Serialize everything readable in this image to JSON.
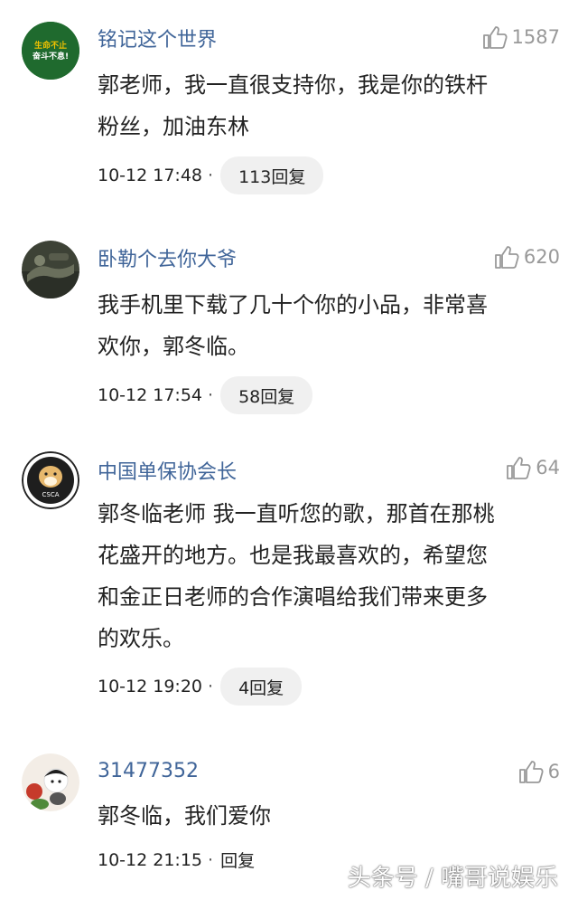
{
  "comments": [
    {
      "username": "铭记这个世界",
      "likes": "1587",
      "content_lines": [
        "郭老师，我一直很支持你，我是你的铁杆",
        "粉丝，加油东林"
      ],
      "time": "10-12 17:48",
      "replies": "113回复",
      "avatar_text_1": "生命不止",
      "avatar_text_2": "奋斗不息!"
    },
    {
      "username": "卧勒个去你大爷",
      "likes": "620",
      "content_lines": [
        "我手机里下载了几十个你的小品，非常喜",
        "欢你，郭冬临。"
      ],
      "time": "10-12 17:54",
      "replies": "58回复"
    },
    {
      "username": "中国单保协会长",
      "likes": "64",
      "content_lines": [
        "郭冬临老师 我一直听您的歌，那首在那桃",
        "花盛开的地方。也是我最喜欢的，希望您",
        "和金正日老师的合作演唱给我们带来更多",
        "的欢乐。"
      ],
      "time": "10-12 19:20",
      "replies": "4回复",
      "avatar_text_1": "CSCA"
    },
    {
      "username": "31477352",
      "likes": "6",
      "content_lines": [
        "郭冬临，我们爱你"
      ],
      "time": "10-12 21:15",
      "replies": "回复"
    }
  ],
  "separator": "·",
  "watermark": "头条号 / 嘴哥说娱乐",
  "colors": {
    "username": "#406599",
    "muted": "#999999",
    "pill": "#f0f0f0"
  },
  "icons": {
    "like": "thumbs-up-icon"
  }
}
